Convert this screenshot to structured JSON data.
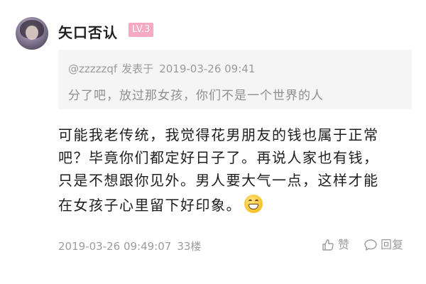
{
  "user": {
    "name": "矢口否认",
    "level": "LV.3"
  },
  "quote": {
    "author": "@zzzzzqf",
    "posted_label": "发表于",
    "datetime": "2019-03-26 09:41",
    "text": "分了吧，放过那女孩，你们不是一个世界的人"
  },
  "content": {
    "lines": [
      "可能我老传统，我觉得花男朋友的钱也属于正常",
      "吧？毕竟你们都定好日子了。再说人家也有钱，",
      "只是不想跟你见外。男人要大气一点，这样才能",
      "在女孩子心里留下好印象。"
    ],
    "emoji": "grinning-face-icon"
  },
  "footer": {
    "datetime": "2019-03-26 09:49:07",
    "floor": "33楼",
    "like_label": "赞",
    "reply_label": "回复"
  }
}
